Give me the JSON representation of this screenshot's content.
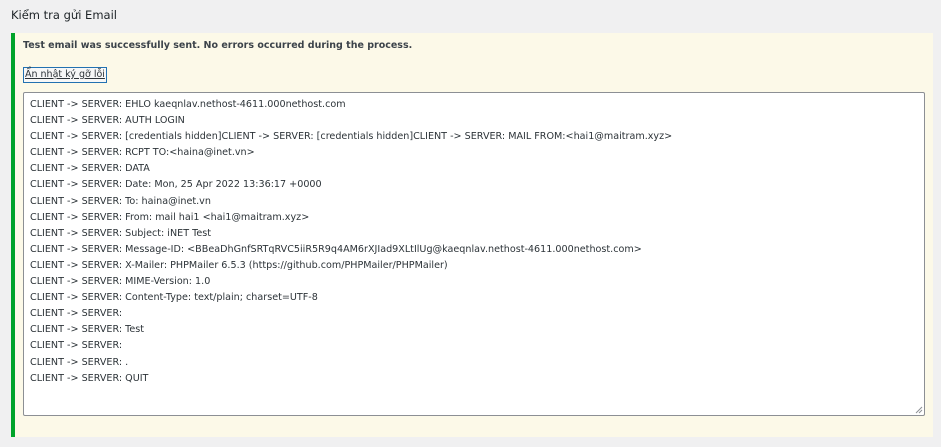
{
  "section": {
    "title": "Kiểm tra gửi Email"
  },
  "notice": {
    "message": "Test email was successfully sent. No errors occurred during the process.",
    "toggle_label": "Ẩn nhật ký gỡ lỗi",
    "status_color": "#00a32a",
    "background_color": "#fcf9e8"
  },
  "log": {
    "lines": [
      "CLIENT -> SERVER: EHLO kaeqnlav.nethost-4611.000nethost.com",
      "CLIENT -> SERVER: AUTH LOGIN",
      "CLIENT -> SERVER: [credentials hidden]CLIENT -> SERVER: [credentials hidden]CLIENT -> SERVER: MAIL FROM:<hai1@maitram.xyz>",
      "CLIENT -> SERVER: RCPT TO:<haina@inet.vn>",
      "CLIENT -> SERVER: DATA",
      "CLIENT -> SERVER: Date: Mon, 25 Apr 2022 13:36:17 +0000",
      "CLIENT -> SERVER: To: haina@inet.vn",
      "CLIENT -> SERVER: From: mail hai1 <hai1@maitram.xyz>",
      "CLIENT -> SERVER: Subject: iNET Test",
      "CLIENT -> SERVER: Message-ID: <BBeaDhGnfSRTqRVC5iiR5R9q4AM6rXJIad9XLtIlUg@kaeqnlav.nethost-4611.000nethost.com>",
      "CLIENT -> SERVER: X-Mailer: PHPMailer 6.5.3 (https://github.com/PHPMailer/PHPMailer)",
      "CLIENT -> SERVER: MIME-Version: 1.0",
      "CLIENT -> SERVER: Content-Type: text/plain; charset=UTF-8",
      "CLIENT -> SERVER: ",
      "CLIENT -> SERVER: Test",
      "CLIENT -> SERVER: ",
      "CLIENT -> SERVER: .",
      "CLIENT -> SERVER: QUIT"
    ]
  }
}
